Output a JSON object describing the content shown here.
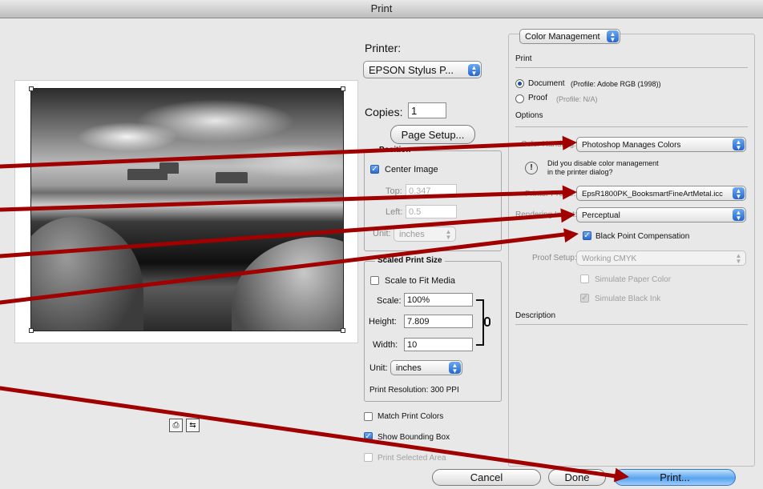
{
  "window": {
    "title": "Print"
  },
  "printer": {
    "label": "Printer:",
    "selected": "EPSON Stylus P..."
  },
  "copies": {
    "label": "Copies:",
    "value": "1"
  },
  "page_setup_label": "Page Setup...",
  "position": {
    "title": "Position",
    "center_image_label": "Center Image",
    "top_label": "Top:",
    "top_value": "0.347",
    "left_label": "Left:",
    "left_value": "0.5",
    "unit_label": "Unit:",
    "unit_value": "inches"
  },
  "scaled": {
    "title": "Scaled Print Size",
    "scale_to_fit_label": "Scale to Fit Media",
    "scale_label": "Scale:",
    "scale_value": "100%",
    "height_label": "Height:",
    "height_value": "7.809",
    "width_label": "Width:",
    "width_value": "10",
    "unit_label": "Unit:",
    "unit_value": "inches",
    "resolution": "Print Resolution: 300 PPI"
  },
  "options_left": {
    "match_print_colors": "Match Print Colors",
    "show_bounding_box": "Show Bounding Box",
    "print_selected_area": "Print Selected Area"
  },
  "color_management": {
    "section_popup": "Color Management",
    "print_heading": "Print",
    "document_label": "Document",
    "document_profile": "(Profile: Adobe RGB (1998))",
    "proof_label": "Proof",
    "proof_profile": "(Profile: N/A)",
    "options_heading": "Options",
    "color_handling_label": "Color Handling:",
    "color_handling_value": "Photoshop Manages Colors",
    "warning_line1": "Did you disable color management",
    "warning_line2": "in the printer dialog?",
    "printer_profile_label": "Printer Profile:",
    "printer_profile_value": "EpsR1800PK_BooksmartFineArtMetal.icc",
    "rendering_intent_label": "Rendering Intent:",
    "rendering_intent_value": "Perceptual",
    "black_point_label": "Black Point Compensation",
    "proof_setup_label": "Proof Setup:",
    "proof_setup_value": "Working CMYK",
    "simulate_paper_label": "Simulate Paper Color",
    "simulate_ink_label": "Simulate Black Ink",
    "description_heading": "Description"
  },
  "buttons": {
    "cancel": "Cancel",
    "done": "Done",
    "print": "Print..."
  },
  "colors": {
    "arrow": "#a00000",
    "accent": "#2a69d1"
  }
}
